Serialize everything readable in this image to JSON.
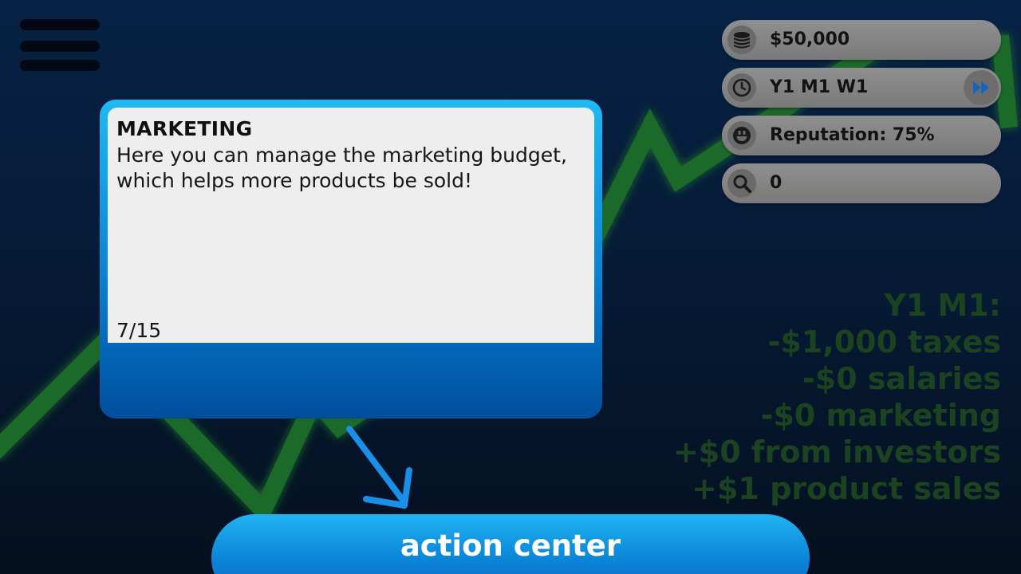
{
  "menu": {
    "icon": "hamburger-icon"
  },
  "stats": {
    "money": {
      "icon": "coins-icon",
      "value": "$50,000"
    },
    "date": {
      "icon": "clock-icon",
      "value": "Y1 M1 W1",
      "speed_icon": "fast-forward-icon"
    },
    "reputation": {
      "icon": "smiley-icon",
      "value": "Reputation: 75%"
    },
    "research": {
      "icon": "magnifier-icon",
      "value": "0"
    }
  },
  "tutorial": {
    "title": "MARKETING",
    "body": "Here you can manage the marketing budget, which helps more products be sold!",
    "step": "7/15"
  },
  "month_summary": {
    "heading": "Y1 M1:",
    "lines": [
      "-$1,000 taxes",
      "-$0 salaries",
      "-$0 marketing",
      "+$0 from investors",
      "+$1 product sales"
    ]
  },
  "action_center": {
    "label": "action center"
  },
  "colors": {
    "accent_blue": "#0a86d8",
    "graph_green": "#1f6b2a",
    "summary_green": "#1b431f",
    "pill_gray": "#8a8a8a"
  }
}
